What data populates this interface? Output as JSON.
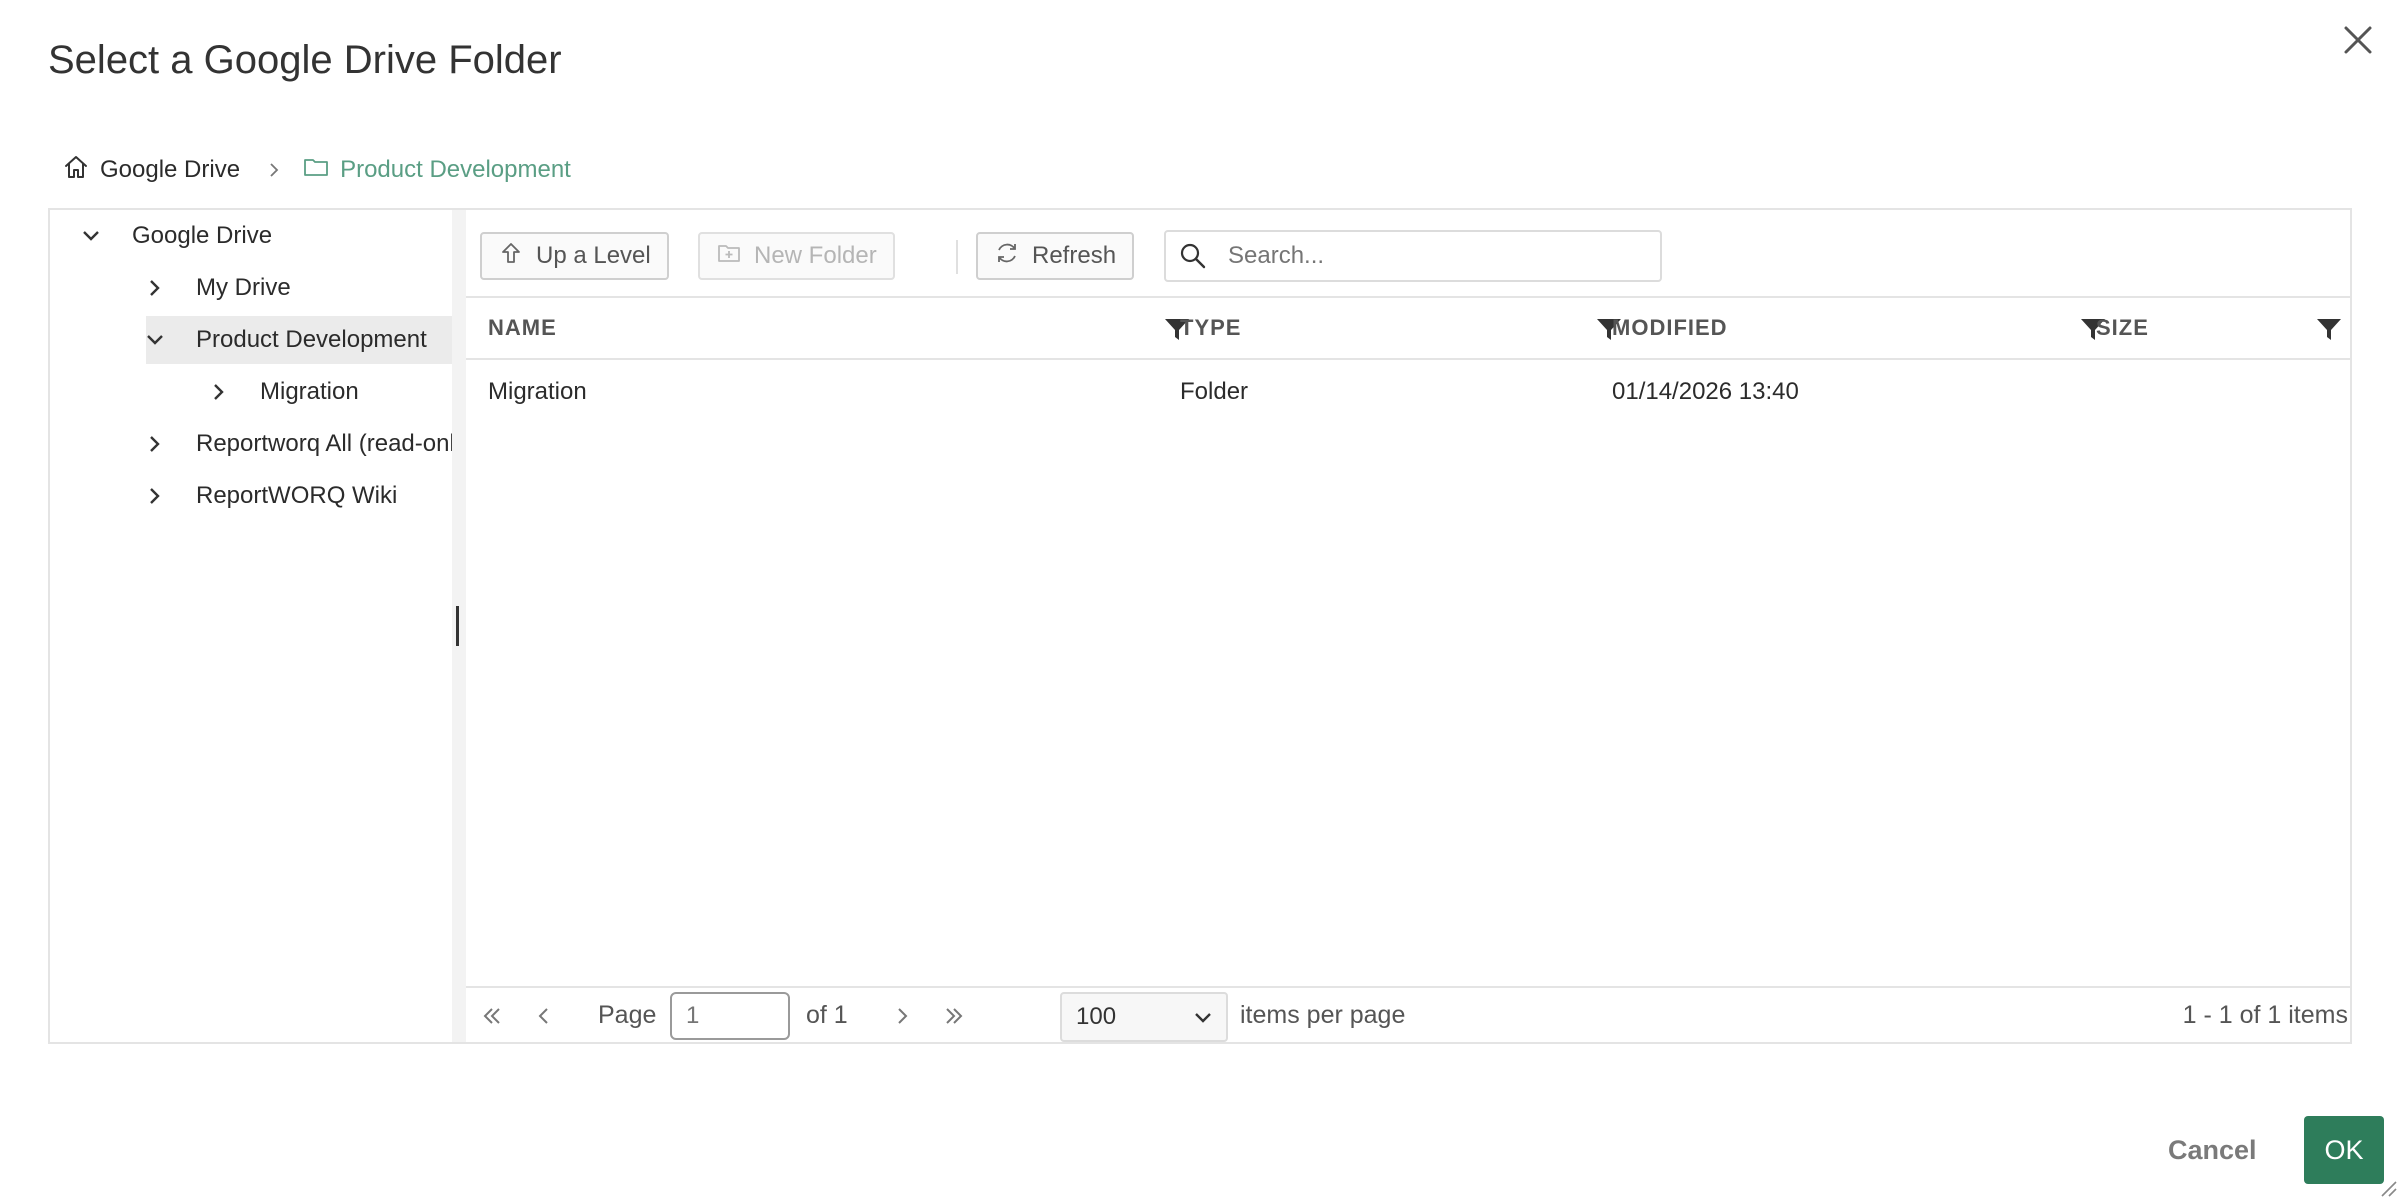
{
  "dialog": {
    "title": "Select a Google Drive Folder",
    "close_icon": "close-icon"
  },
  "breadcrumb": {
    "items": [
      {
        "label": "Google Drive",
        "icon": "home-icon"
      },
      {
        "label": "Product Development",
        "icon": "folder-icon"
      }
    ],
    "current_color": "#5a9e84"
  },
  "tree": {
    "items": [
      {
        "label": "Google Drive",
        "expanded": true,
        "selected": false
      },
      {
        "label": "My Drive",
        "expanded": false,
        "selected": false
      },
      {
        "label": "Product Development",
        "expanded": true,
        "selected": true
      },
      {
        "label": "Migration",
        "expanded": false,
        "selected": false
      },
      {
        "label": "Reportworq All (read-onl",
        "expanded": false,
        "selected": false
      },
      {
        "label": "ReportWORQ Wiki",
        "expanded": false,
        "selected": false
      }
    ]
  },
  "toolbar": {
    "up_level_label": "Up a Level",
    "new_folder_label": "New Folder",
    "refresh_label": "Refresh",
    "search_placeholder": "Search...",
    "search_value": ""
  },
  "grid": {
    "columns": [
      "NAME",
      "TYPE",
      "MODIFIED",
      "SIZE"
    ],
    "rows": [
      {
        "name": "Migration",
        "type": "Folder",
        "modified": "01/14/2026 13:40",
        "size": ""
      }
    ]
  },
  "pager": {
    "page_label": "Page",
    "page_placeholder": "1",
    "of_label": "of 1",
    "page_size": "100",
    "items_per_page_label": "items per page",
    "summary": "1 - 1 of 1 items"
  },
  "footer": {
    "cancel_label": "Cancel",
    "ok_label": "OK",
    "ok_color": "#2e7d5b"
  }
}
